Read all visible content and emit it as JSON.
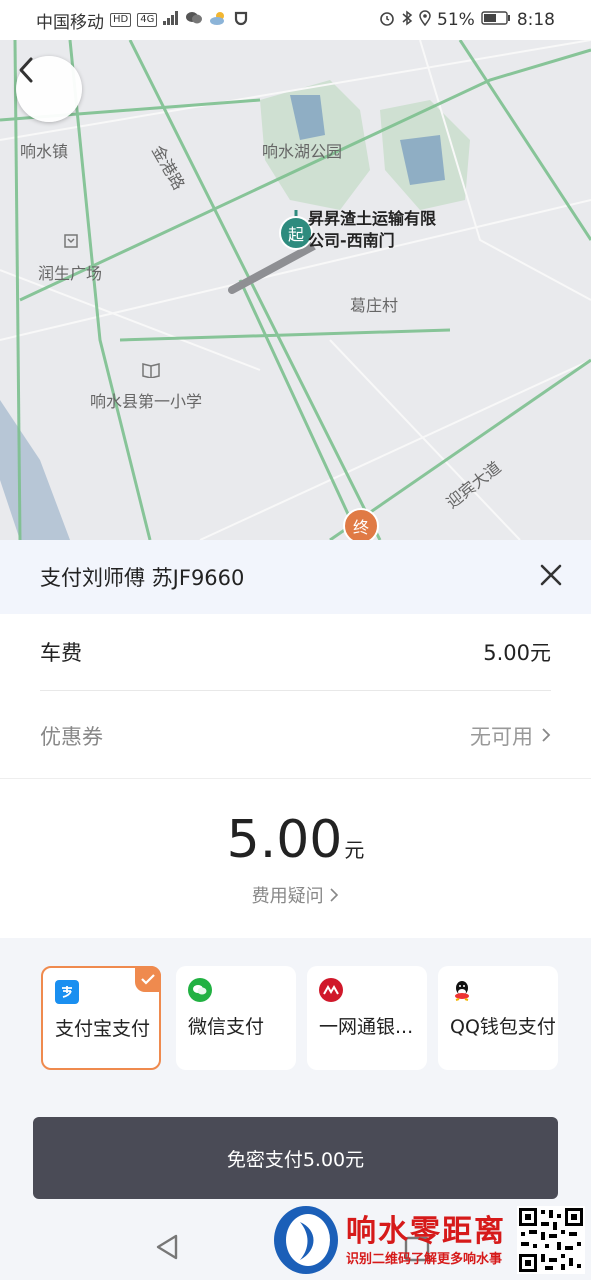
{
  "status_bar": {
    "carrier": "中国移动",
    "hd": "HD",
    "network": "4G",
    "battery": "51%",
    "time": "8:18"
  },
  "map": {
    "labels": {
      "town": "响水镇",
      "park": "响水湖公园",
      "road_jingang": "金港路",
      "plaza": "润生广场",
      "village": "葛庄村",
      "school": "响水县第一小学",
      "avenue": "迎宾大道"
    },
    "pickup_name": "昇昇渣土运输有限公司-西南门",
    "start_marker": "起",
    "end_marker": "终"
  },
  "sheet": {
    "title": "支付刘师傅 苏JF9660",
    "fee_label": "车费",
    "fee_value": "5.00元",
    "coupon_label": "优惠券",
    "coupon_value": "无可用",
    "amount": "5.00",
    "amount_unit": "元",
    "fee_question": "费用疑问"
  },
  "payment_methods": [
    {
      "label": "支付宝支付",
      "icon": "alipay-icon",
      "color": "#1a8ff0",
      "selected": true
    },
    {
      "label": "微信支付",
      "icon": "wechat-pay-icon",
      "color": "#21b142",
      "selected": false
    },
    {
      "label": "一网通银...",
      "icon": "cmb-icon",
      "color": "#d0182a",
      "selected": false
    },
    {
      "label": "QQ钱包支付",
      "icon": "qq-wallet-icon",
      "color": "#111111",
      "selected": false
    }
  ],
  "pay_button": "免密支付5.00元",
  "watermark": {
    "title": "响水零距离",
    "subtitle": "识别二维码了解更多响水事"
  },
  "colors": {
    "accent": "#ef8a4e",
    "button": "#4a4b56",
    "start": "#2e8b7e",
    "end": "#e07a45"
  }
}
